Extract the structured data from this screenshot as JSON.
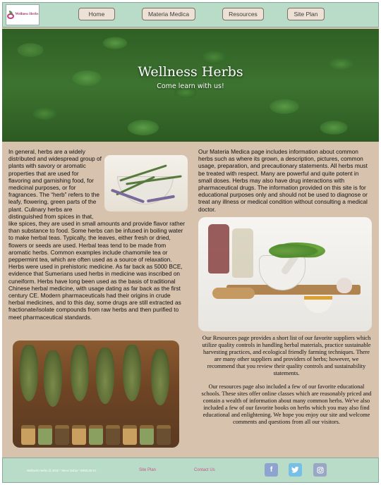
{
  "nav": {
    "logo_text": "Wellness Herbs",
    "items": [
      {
        "label": "Home"
      },
      {
        "label": "Materia Medica"
      },
      {
        "label": "Resources"
      },
      {
        "label": "Site Plan"
      }
    ]
  },
  "hero": {
    "title": "Wellness Herbs",
    "subtitle": "Come learn with us!"
  },
  "main": {
    "left_paragraph": "In general, herbs are a widely distributed and widespread group of plants with savory or aromatic properties that are used for flavoring and garnishing food, for medicinal purposes, or for fragrances. The “herb” refers to the leafy, flowering, green parts of the plant. Culinary herbs are distinguished from spices in that, like spices, they are used in small amounts and provide flavor rather than substance to food. Some herbs can be infused in boiling water to make herbal teas. Typically, the leaves, either fresh or dried, flowers or seeds are used. Herbal teas tend to be made from aromatic herbs. Common examples include chamomile tea or peppermint tea, which are often used as a source of relaxation. Herbs were used in prehistoric medicine. As far back as 5000 BCE, evidence that Sumerians used herbs in medicine was inscribed on cuneiform. Herbs have long been used as the basis of traditional Chinese herbal medicine, with usage dating as far back as the first century CE. Modern pharmaceuticals had their origins in crude herbal medicines, and to this day, some drugs are still extracted as fractionate/isolate compounds from raw herbs and then purified to meet pharmaceutical standards.",
    "right_paragraph": "Our Materia Medica page includes information about common herbs such as where its grown, a description, pictures, common usage, preparation, and precautionary statements. All herbs must be treated with respect. Many are powerful and quite potent in small doses. Herbs may also have drug interactions with pharmaceutical drugs. The information provided on this site is for educational purposes only and should not be used to diagnose or treat any illness or medical condition without consulting a medical doctor.",
    "resources_paragraph_1": "Our Resources page provides a short list of our favorite suppliers which utilize quality controls in handling herbal materials, practice sustainable harvesting practices, and ecological friendly farming techniques. There are many other suppliers and providers of herbs; however, we recommend that you review their quality controls and sustainability statements.",
    "resources_paragraph_2": "Our resources page also included a few of our favorite educational schools. These sites offer online classes which are reasonably priced and contain a wealth of information about many common herbs. We've also included a few of our favorite books on herbs which you may also find educational and enlightening. We hope you enjoy our site and welcome comments and questions from all our visitors."
  },
  "footer": {
    "copyright": "Wellness Herbs @ 2022 * Steve Dubia * WEB130-01",
    "links": [
      {
        "label": "Site Plan"
      },
      {
        "label": "Contact Us"
      }
    ],
    "social": [
      {
        "icon": "facebook-icon",
        "glyph": "f"
      },
      {
        "icon": "twitter-icon"
      },
      {
        "icon": "instagram-icon"
      }
    ]
  },
  "colors": {
    "nav_bg": "#b9dcc8",
    "page_bg": "#d6c2ad",
    "button_bg": "#ede0d4",
    "footer_link": "#c4558a"
  }
}
